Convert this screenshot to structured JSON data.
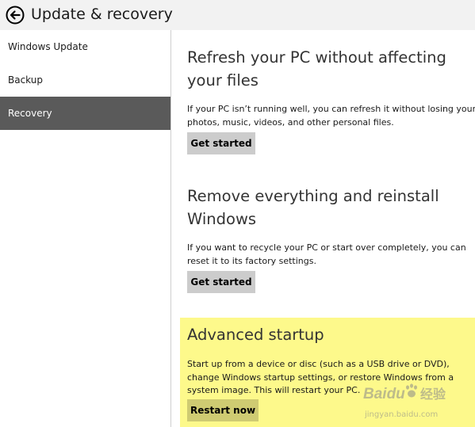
{
  "header": {
    "title": "Update & recovery",
    "back_icon": "back-arrow-icon"
  },
  "sidebar": {
    "items": [
      {
        "label": "Windows Update",
        "selected": false
      },
      {
        "label": "Backup",
        "selected": false
      },
      {
        "label": "Recovery",
        "selected": true
      }
    ]
  },
  "main": {
    "sections": [
      {
        "title": "Refresh your PC without affecting your files",
        "description": "If your PC isn’t running well, you can refresh it without losing your photos, music, videos, and other personal files.",
        "button": "Get started"
      },
      {
        "title": "Remove everything and reinstall Windows",
        "description": "If you want to recycle your PC or start over completely, you can reset it to its factory settings.",
        "button": "Get started"
      },
      {
        "title": "Advanced startup",
        "description": "Start up from a device or disc (such as a USB drive or DVD), change Windows startup settings, or restore Windows from a system image. This will restart your PC.",
        "button": "Restart now",
        "highlighted": true
      }
    ]
  },
  "watermark": {
    "brand": "Baidu",
    "label": "经验",
    "url": "jingyan.baidu.com"
  },
  "colors": {
    "header_bg": "#f2f2f2",
    "selected_nav_bg": "#5a5a5a",
    "button_bg": "#cccccc",
    "highlight": "#fdf98b",
    "divider": "#cfcfcf"
  }
}
